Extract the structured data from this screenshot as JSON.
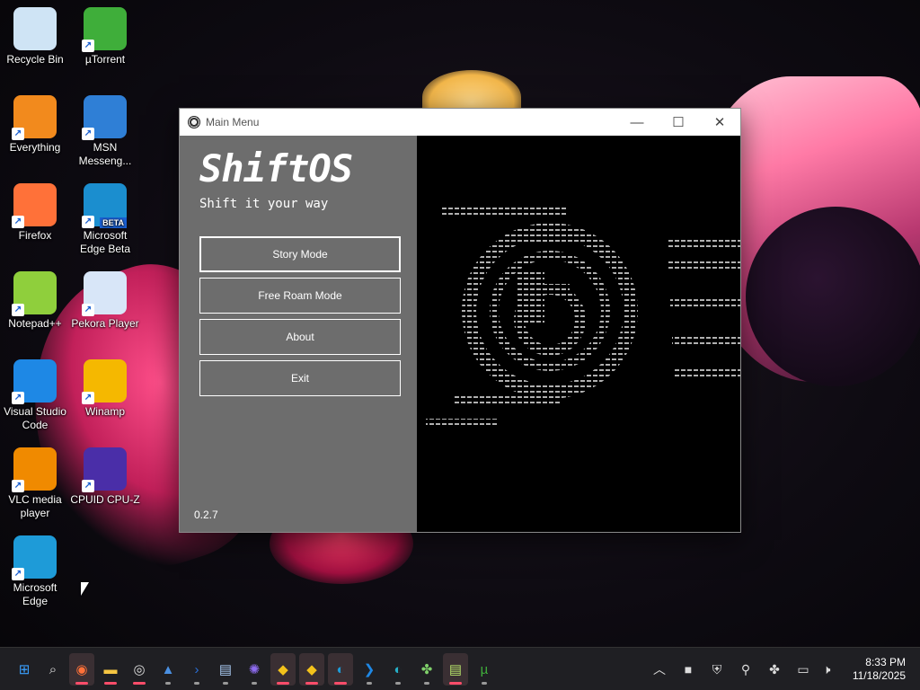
{
  "desktop": {
    "icons": [
      {
        "label": "Recycle Bin",
        "icon": "recycle-bin-icon",
        "color": "#cfe4f5"
      },
      {
        "label": "µTorrent",
        "icon": "utorrent-icon",
        "color": "#3fae3a"
      },
      {
        "label": "Everything",
        "icon": "everything-search-icon",
        "color": "#f28a1d"
      },
      {
        "label": "MSN Messeng...",
        "icon": "msn-messenger-icon",
        "color": "#2f7fd6"
      },
      {
        "label": "Firefox",
        "icon": "firefox-icon",
        "color": "#ff7139"
      },
      {
        "label": "Microsoft Edge Beta",
        "icon": "edge-beta-icon",
        "color": "#1b8ecf"
      },
      {
        "label": "Notepad++",
        "icon": "notepadpp-icon",
        "color": "#8fcf3c"
      },
      {
        "label": "Pekora Player",
        "icon": "pekora-player-icon",
        "color": "#d8e6f8"
      },
      {
        "label": "Visual Studio Code",
        "icon": "vscode-icon",
        "color": "#1e88e5"
      },
      {
        "label": "Winamp",
        "icon": "winamp-icon",
        "color": "#f5b800"
      },
      {
        "label": "VLC media player",
        "icon": "vlc-icon",
        "color": "#f08a00"
      },
      {
        "label": "CPUID CPU-Z",
        "icon": "cpuz-icon",
        "color": "#4a2ea8"
      },
      {
        "label": "Microsoft Edge",
        "icon": "edge-icon",
        "color": "#1e9bd8"
      }
    ],
    "beta_badge": "BETA"
  },
  "window": {
    "title": "Main Menu",
    "controls": {
      "minimize": "—",
      "maximize": "☐",
      "close": "✕"
    },
    "brand": "ShiftOS",
    "tagline": "Shift it your way",
    "buttons": [
      "Story Mode",
      "Free Roam Mode",
      "About",
      "Exit"
    ],
    "version": "0.2.7"
  },
  "taskbar": {
    "items": [
      {
        "icon": "start-icon",
        "glyph": "⊞",
        "color": "#3aa0ff"
      },
      {
        "icon": "search-icon",
        "glyph": "⌕",
        "color": "#dddddd"
      },
      {
        "icon": "firefox-icon",
        "glyph": "◉",
        "color": "#ff7139"
      },
      {
        "icon": "file-explorer-icon",
        "glyph": "▬",
        "color": "#f5c542"
      },
      {
        "icon": "shiftos-icon",
        "glyph": "◎",
        "color": "#dddddd"
      },
      {
        "icon": "task-manager-icon",
        "glyph": "▲",
        "color": "#4a90e2"
      },
      {
        "icon": "powershell-icon",
        "glyph": "›",
        "color": "#2a6fd6"
      },
      {
        "icon": "notepad-icon",
        "glyph": "▤",
        "color": "#a8c8f0"
      },
      {
        "icon": "app-purple-icon",
        "glyph": "✺",
        "color": "#8e6cf0"
      },
      {
        "icon": "security-shield-icon",
        "glyph": "◆",
        "color": "#f3c21b"
      },
      {
        "icon": "security-shield-2-icon",
        "glyph": "◆",
        "color": "#f3c21b"
      },
      {
        "icon": "edge-icon",
        "glyph": "◐",
        "color": "#1e9bd8"
      },
      {
        "icon": "vscode-icon",
        "glyph": "❯",
        "color": "#1e88e5"
      },
      {
        "icon": "edge-beta-icon",
        "glyph": "◐",
        "color": "#26b0c8"
      },
      {
        "icon": "puzzle-app-icon",
        "glyph": "✤",
        "color": "#7fd06a"
      },
      {
        "icon": "notepadpp-icon",
        "glyph": "▤",
        "color": "#b5e06a"
      },
      {
        "icon": "utorrent-icon",
        "glyph": "µ",
        "color": "#3fae3a"
      }
    ],
    "tray": [
      {
        "icon": "chevron-up-icon",
        "glyph": "︿"
      },
      {
        "icon": "blue-square-icon",
        "glyph": "■"
      },
      {
        "icon": "defender-warning-icon",
        "glyph": "⛨"
      },
      {
        "icon": "everything-tray-icon",
        "glyph": "⚲"
      },
      {
        "icon": "network-app-icon",
        "glyph": "✤"
      },
      {
        "icon": "display-icon",
        "glyph": "▭"
      },
      {
        "icon": "volume-muted-icon",
        "glyph": "🕨"
      }
    ],
    "time": "8:33 PM",
    "date": "11/18/2025"
  }
}
